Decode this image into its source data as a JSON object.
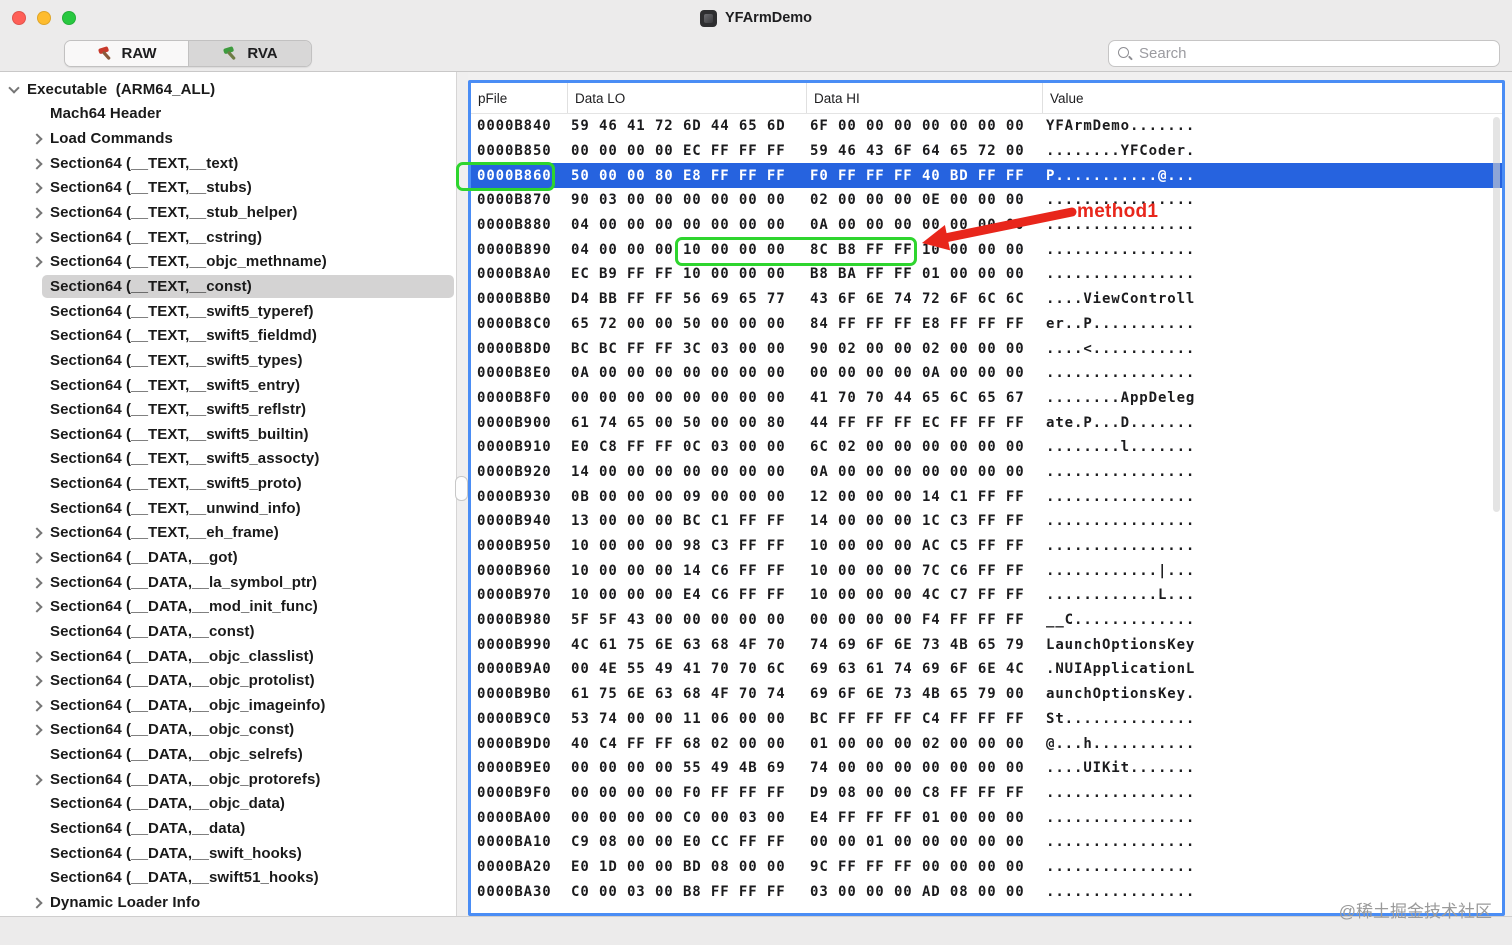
{
  "window": {
    "title": "YFArmDemo"
  },
  "toolbar": {
    "raw_label": "RAW",
    "rva_label": "RVA",
    "search_placeholder": "Search"
  },
  "colors": {
    "selection_blue": "#2663DF",
    "focus_border_blue": "#4A8DF5",
    "annotation_green": "#2ED52E",
    "annotation_red": "#E8261B",
    "traffic_red": "#FF5F57",
    "traffic_yellow": "#FEBC2E",
    "traffic_green": "#28C840"
  },
  "sidebar": {
    "items": [
      {
        "label": "Executable  (ARM64_ALL)",
        "variant": "down",
        "top": true
      },
      {
        "label": "Mach64 Header"
      },
      {
        "label": "Load Commands",
        "variant": "right"
      },
      {
        "label": "Section64 (__TEXT,__text)",
        "variant": "right"
      },
      {
        "label": "Section64 (__TEXT,__stubs)",
        "variant": "right"
      },
      {
        "label": "Section64 (__TEXT,__stub_helper)",
        "variant": "right"
      },
      {
        "label": "Section64 (__TEXT,__cstring)",
        "variant": "right"
      },
      {
        "label": "Section64 (__TEXT,__objc_methname)",
        "variant": "right"
      },
      {
        "label": "Section64 (__TEXT,__const)",
        "selected": true
      },
      {
        "label": "Section64 (__TEXT,__swift5_typeref)"
      },
      {
        "label": "Section64 (__TEXT,__swift5_fieldmd)"
      },
      {
        "label": "Section64 (__TEXT,__swift5_types)"
      },
      {
        "label": "Section64 (__TEXT,__swift5_entry)"
      },
      {
        "label": "Section64 (__TEXT,__swift5_reflstr)"
      },
      {
        "label": "Section64 (__TEXT,__swift5_builtin)"
      },
      {
        "label": "Section64 (__TEXT,__swift5_assocty)"
      },
      {
        "label": "Section64 (__TEXT,__swift5_proto)"
      },
      {
        "label": "Section64 (__TEXT,__unwind_info)"
      },
      {
        "label": "Section64 (__TEXT,__eh_frame)",
        "variant": "right"
      },
      {
        "label": "Section64 (__DATA,__got)",
        "variant": "right"
      },
      {
        "label": "Section64 (__DATA,__la_symbol_ptr)",
        "variant": "right"
      },
      {
        "label": "Section64 (__DATA,__mod_init_func)",
        "variant": "right"
      },
      {
        "label": "Section64 (__DATA,__const)"
      },
      {
        "label": "Section64 (__DATA,__objc_classlist)",
        "variant": "right"
      },
      {
        "label": "Section64 (__DATA,__objc_protolist)",
        "variant": "right"
      },
      {
        "label": "Section64 (__DATA,__objc_imageinfo)",
        "variant": "right"
      },
      {
        "label": "Section64 (__DATA,__objc_const)",
        "variant": "right"
      },
      {
        "label": "Section64 (__DATA,__objc_selrefs)"
      },
      {
        "label": "Section64 (__DATA,__objc_protorefs)",
        "variant": "right"
      },
      {
        "label": "Section64 (__DATA,__objc_data)"
      },
      {
        "label": "Section64 (__DATA,__data)"
      },
      {
        "label": "Section64 (__DATA,__swift_hooks)"
      },
      {
        "label": "Section64 (__DATA,__swift51_hooks)"
      },
      {
        "label": "Dynamic Loader Info",
        "variant": "right"
      }
    ]
  },
  "hexview": {
    "columns": [
      "pFile",
      "Data LO",
      "Data HI",
      "Value"
    ],
    "rows": [
      {
        "addr": "0000B840",
        "lo": "59 46 41 72 6D 44 65 6D",
        "hi": "6F 00 00 00 00 00 00 00",
        "value": "YFArmDemo......."
      },
      {
        "addr": "0000B850",
        "lo": "00 00 00 00 EC FF FF FF",
        "hi": "59 46 43 6F 64 65 72 00",
        "value": "........YFCoder."
      },
      {
        "addr": "0000B860",
        "lo": "50 00 00 80 E8 FF FF FF",
        "hi": "F0 FF FF FF 40 BD FF FF",
        "value": "P...........@...",
        "selected": true
      },
      {
        "addr": "0000B870",
        "lo": "90 03 00 00 00 00 00 00",
        "hi": "02 00 00 00 0E 00 00 00",
        "value": "................"
      },
      {
        "addr": "0000B880",
        "lo": "04 00 00 00 00 00 00 00",
        "hi": "0A 00 00 00 00 00 00 00",
        "value": "................"
      },
      {
        "addr": "0000B890",
        "lo": "04 00 00 00 10 00 00 00",
        "hi": "8C B8 FF FF 10 00 00 00",
        "value": "................"
      },
      {
        "addr": "0000B8A0",
        "lo": "EC B9 FF FF 10 00 00 00",
        "hi": "B8 BA FF FF 01 00 00 00",
        "value": "................"
      },
      {
        "addr": "0000B8B0",
        "lo": "D4 BB FF FF 56 69 65 77",
        "hi": "43 6F 6E 74 72 6F 6C 6C",
        "value": "....ViewControll"
      },
      {
        "addr": "0000B8C0",
        "lo": "65 72 00 00 50 00 00 00",
        "hi": "84 FF FF FF E8 FF FF FF",
        "value": "er..P..........."
      },
      {
        "addr": "0000B8D0",
        "lo": "BC BC FF FF 3C 03 00 00",
        "hi": "90 02 00 00 02 00 00 00",
        "value": "....<..........."
      },
      {
        "addr": "0000B8E0",
        "lo": "0A 00 00 00 00 00 00 00",
        "hi": "00 00 00 00 0A 00 00 00",
        "value": "................"
      },
      {
        "addr": "0000B8F0",
        "lo": "00 00 00 00 00 00 00 00",
        "hi": "41 70 70 44 65 6C 65 67",
        "value": "........AppDeleg"
      },
      {
        "addr": "0000B900",
        "lo": "61 74 65 00 50 00 00 80",
        "hi": "44 FF FF FF EC FF FF FF",
        "value": "ate.P...D......."
      },
      {
        "addr": "0000B910",
        "lo": "E0 C8 FF FF 0C 03 00 00",
        "hi": "6C 02 00 00 00 00 00 00",
        "value": "........l......."
      },
      {
        "addr": "0000B920",
        "lo": "14 00 00 00 00 00 00 00",
        "hi": "0A 00 00 00 00 00 00 00",
        "value": "................"
      },
      {
        "addr": "0000B930",
        "lo": "0B 00 00 00 09 00 00 00",
        "hi": "12 00 00 00 14 C1 FF FF",
        "value": "................"
      },
      {
        "addr": "0000B940",
        "lo": "13 00 00 00 BC C1 FF FF",
        "hi": "14 00 00 00 1C C3 FF FF",
        "value": "................"
      },
      {
        "addr": "0000B950",
        "lo": "10 00 00 00 98 C3 FF FF",
        "hi": "10 00 00 00 AC C5 FF FF",
        "value": "................"
      },
      {
        "addr": "0000B960",
        "lo": "10 00 00 00 14 C6 FF FF",
        "hi": "10 00 00 00 7C C6 FF FF",
        "value": "............|..."
      },
      {
        "addr": "0000B970",
        "lo": "10 00 00 00 E4 C6 FF FF",
        "hi": "10 00 00 00 4C C7 FF FF",
        "value": "............L..."
      },
      {
        "addr": "0000B980",
        "lo": "5F 5F 43 00 00 00 00 00",
        "hi": "00 00 00 00 F4 FF FF FF",
        "value": "__C............."
      },
      {
        "addr": "0000B990",
        "lo": "4C 61 75 6E 63 68 4F 70",
        "hi": "74 69 6F 6E 73 4B 65 79",
        "value": "LaunchOptionsKey"
      },
      {
        "addr": "0000B9A0",
        "lo": "00 4E 55 49 41 70 70 6C",
        "hi": "69 63 61 74 69 6F 6E 4C",
        "value": ".NUIApplicationL"
      },
      {
        "addr": "0000B9B0",
        "lo": "61 75 6E 63 68 4F 70 74",
        "hi": "69 6F 6E 73 4B 65 79 00",
        "value": "aunchOptionsKey."
      },
      {
        "addr": "0000B9C0",
        "lo": "53 74 00 00 11 06 00 00",
        "hi": "BC FF FF FF C4 FF FF FF",
        "value": "St.............."
      },
      {
        "addr": "0000B9D0",
        "lo": "40 C4 FF FF 68 02 00 00",
        "hi": "01 00 00 00 02 00 00 00",
        "value": "@...h..........."
      },
      {
        "addr": "0000B9E0",
        "lo": "00 00 00 00 55 49 4B 69",
        "hi": "74 00 00 00 00 00 00 00",
        "value": "....UIKit......."
      },
      {
        "addr": "0000B9F0",
        "lo": "00 00 00 00 F0 FF FF FF",
        "hi": "D9 08 00 00 C8 FF FF FF",
        "value": "................"
      },
      {
        "addr": "0000BA00",
        "lo": "00 00 00 00 C0 00 03 00",
        "hi": "E4 FF FF FF 01 00 00 00",
        "value": "................"
      },
      {
        "addr": "0000BA10",
        "lo": "C9 08 00 00 E0 CC FF FF",
        "hi": "00 00 01 00 00 00 00 00",
        "value": "................"
      },
      {
        "addr": "0000BA20",
        "lo": "E0 1D 00 00 BD 08 00 00",
        "hi": "9C FF FF FF 00 00 00 00",
        "value": "................"
      },
      {
        "addr": "0000BA30",
        "lo": "C0 00 03 00 B8 FF FF FF",
        "hi": "03 00 00 00 AD 08 00 00",
        "value": "................"
      }
    ]
  },
  "annotations": {
    "method_label": "method1",
    "highlighted_address": "0000B860",
    "boxed_bytes": "10 00 00 00 8C B8 FF FF"
  },
  "watermark": "@稀土掘金技术社区"
}
